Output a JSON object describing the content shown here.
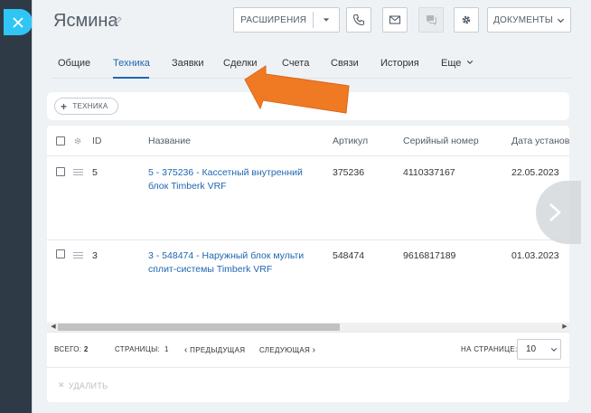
{
  "header": {
    "title": "Ясмина",
    "buttons": {
      "extensions": "РАСШИРЕНИЯ",
      "documents": "ДОКУМЕНТЫ"
    }
  },
  "tabs": [
    {
      "label": "Общие"
    },
    {
      "label": "Техника"
    },
    {
      "label": "Заявки"
    },
    {
      "label": "Сделки"
    },
    {
      "label": "Счета"
    },
    {
      "label": "Связи"
    },
    {
      "label": "История"
    },
    {
      "label": "Еще"
    }
  ],
  "toolbar": {
    "add_label": "ТЕХНИКА"
  },
  "grid": {
    "columns": [
      "ID",
      "Название",
      "Артикул",
      "Серийный номер",
      "Дата установки"
    ],
    "rows": [
      {
        "id": "5",
        "name": "5 - 375236 - Кассетный внутренний блок Timberk VRF",
        "article": "375236",
        "serial": "4110337167",
        "date": "22.05.2023"
      },
      {
        "id": "3",
        "name": "3 - 548474 - Наружный блок мульти сплит-системы Timberk VRF",
        "article": "548474",
        "serial": "9616817189",
        "date": "01.03.2023"
      }
    ]
  },
  "pager": {
    "total_label": "ВСЕГО:",
    "total_value": "2",
    "pages_label": "СТРАНИЦЫ:",
    "pages_value": "1",
    "prev": "ПРЕДЫДУЩАЯ",
    "next": "СЛЕДУЮЩАЯ",
    "per_page_label": "НА СТРАНИЦЕ:",
    "per_page_value": "10"
  },
  "actions": {
    "delete": "УДАЛИТЬ"
  },
  "colors": {
    "accent": "#2067b0",
    "close_button": "#2fc6f6",
    "annotation_arrow": "#f07a24"
  }
}
